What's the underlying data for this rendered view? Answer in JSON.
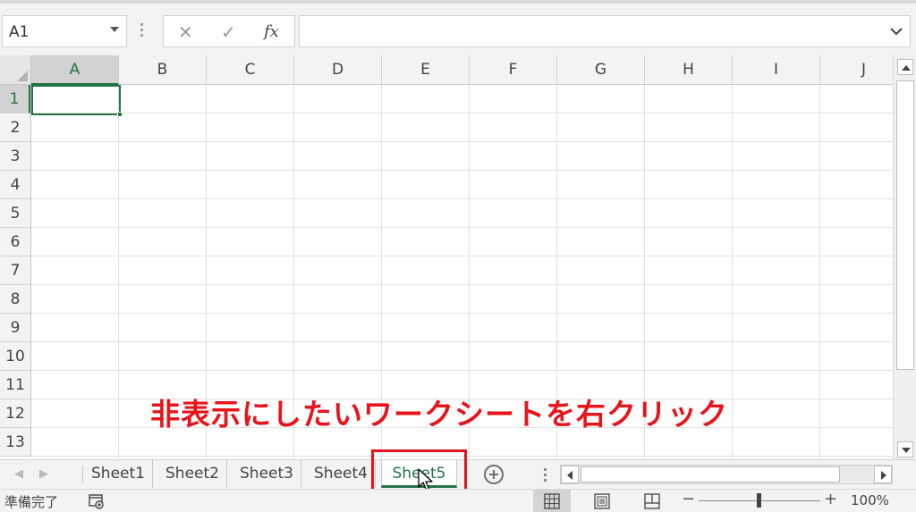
{
  "formula_bar": {
    "name_box": "A1",
    "cancel_glyph": "✕",
    "enter_glyph": "✓",
    "fx_label": "fx",
    "formula_value": ""
  },
  "grid": {
    "columns": [
      "A",
      "B",
      "C",
      "D",
      "E",
      "F",
      "G",
      "H",
      "I",
      "J"
    ],
    "rows": [
      "1",
      "2",
      "3",
      "4",
      "5",
      "6",
      "7",
      "8",
      "9",
      "10",
      "11",
      "12",
      "13"
    ],
    "active_cell": "A1"
  },
  "annotation": "非表示にしたいワークシートを右クリック",
  "sheet_tabs": {
    "tabs": [
      "Sheet1",
      "Sheet2",
      "Sheet3",
      "Sheet4",
      "Sheet5"
    ],
    "active": "Sheet5"
  },
  "status_bar": {
    "status": "準備完了",
    "zoom_minus": "−",
    "zoom_plus": "+",
    "zoom_level": "100%"
  },
  "colors": {
    "excel_green": "#217346",
    "annotation_red": "#e8141b"
  }
}
